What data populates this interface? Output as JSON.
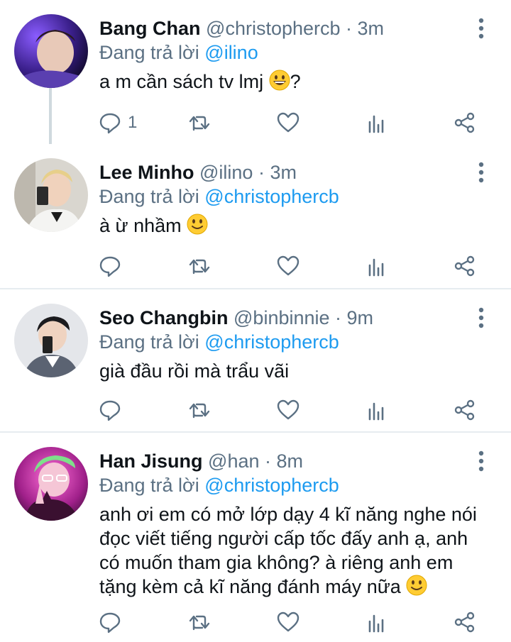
{
  "replying_label": "Đang trả lời",
  "tweets": [
    {
      "name": "Bang Chan",
      "handle": "@christophercb",
      "time": "· 3m",
      "reply_to": "@ilino",
      "text": "a m cần sách tv lmj",
      "text_suffix": "?",
      "emoji": "grinning-face",
      "reply_count": "1"
    },
    {
      "name": "Lee Minho",
      "handle": "@ilino",
      "time": "· 3m",
      "reply_to": "@christophercb",
      "text": "à ừ nhầm",
      "text_suffix": "",
      "emoji": "slightly-smiling-face",
      "reply_count": ""
    },
    {
      "name": "Seo Changbin",
      "handle": "@binbinnie",
      "time": "· 9m",
      "reply_to": "@christophercb",
      "text": "già đầu rồi mà trẩu vãi",
      "text_suffix": "",
      "emoji": "",
      "reply_count": ""
    },
    {
      "name": "Han Jisung",
      "handle": "@han",
      "time": "· 8m",
      "reply_to": "@christophercb",
      "text": "anh ơi em có mở lớp dạy 4 kĩ năng nghe nói đọc viết tiếng người cấp tốc đấy anh ạ, anh có muốn tham gia không? à riêng anh em tặng kèm cả kĩ năng đánh máy nữa",
      "text_suffix": "",
      "emoji": "slightly-smiling-face",
      "reply_count": ""
    }
  ],
  "colors": {
    "accent": "#1d9bf0",
    "secondary_text": "#5b7083",
    "primary_text": "#0f1419",
    "divider": "#e6ecf0",
    "thread_line": "#cfd9de"
  },
  "icons": [
    "reply-icon",
    "retweet-icon",
    "like-icon",
    "analytics-icon",
    "share-icon",
    "more-options-icon"
  ]
}
